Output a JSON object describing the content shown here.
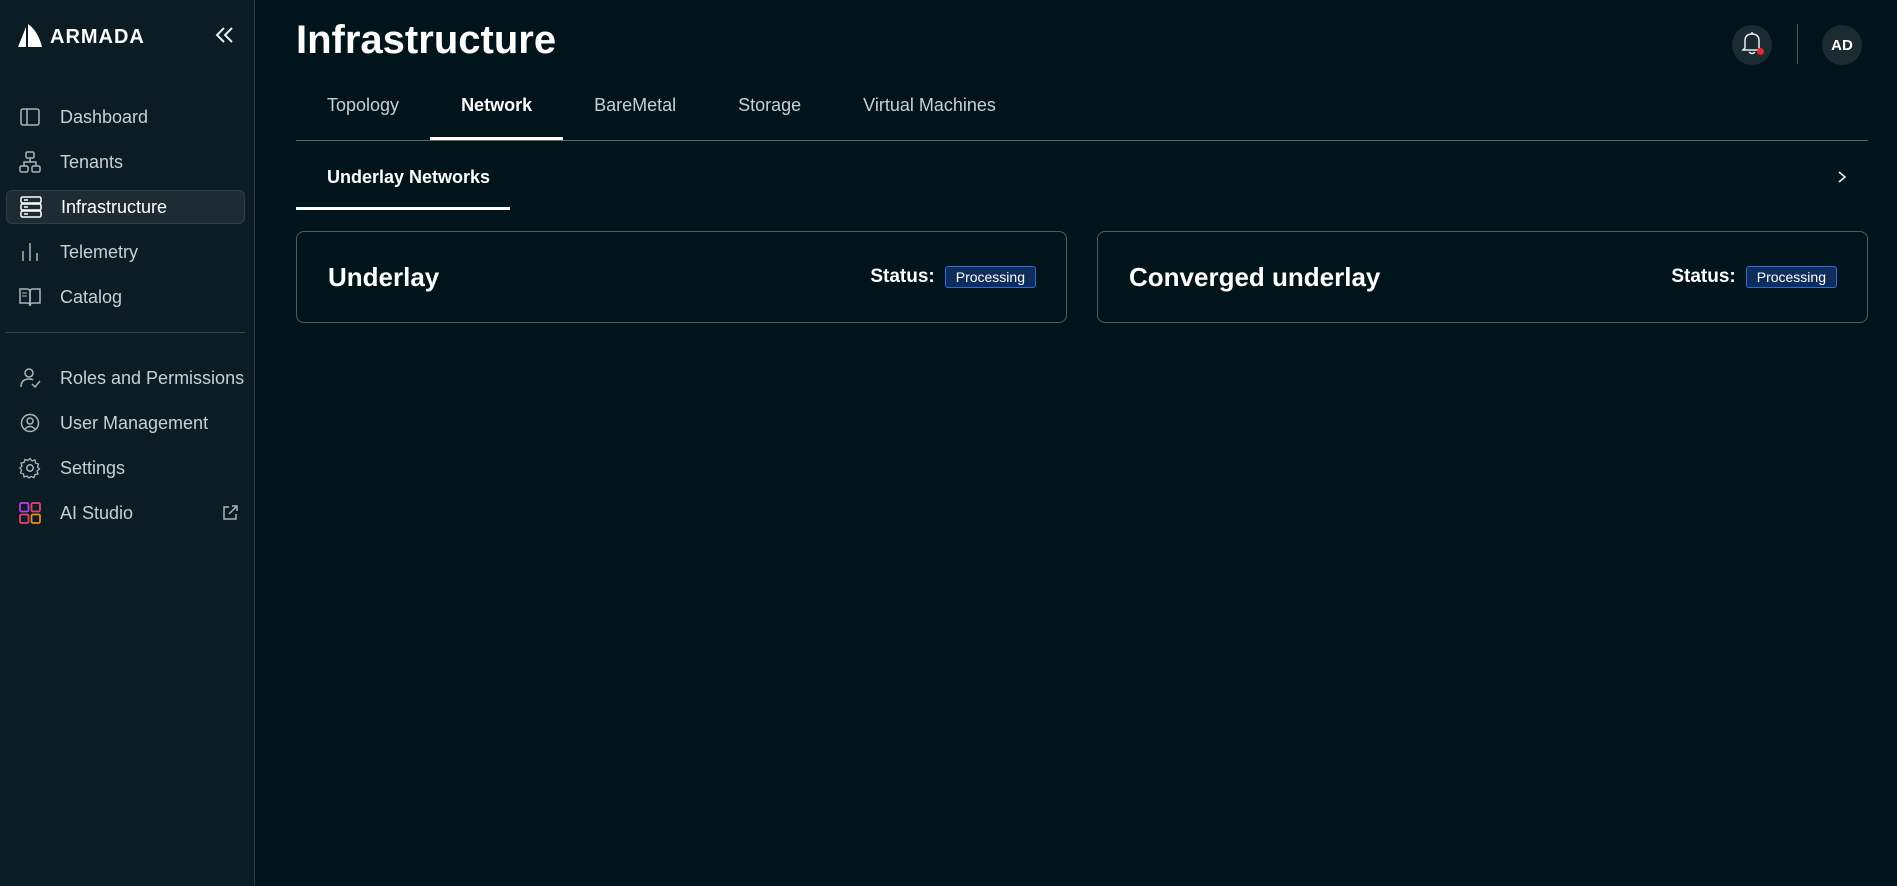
{
  "brand": {
    "name": "ARMADA"
  },
  "sidebar": {
    "primary": [
      {
        "label": "Dashboard",
        "icon": "sidebar-panel-icon",
        "active": false
      },
      {
        "label": "Tenants",
        "icon": "org-hierarchy-icon",
        "active": false
      },
      {
        "label": "Infrastructure",
        "icon": "server-stack-icon",
        "active": true
      },
      {
        "label": "Telemetry",
        "icon": "bar-chart-icon",
        "active": false
      },
      {
        "label": "Catalog",
        "icon": "book-icon",
        "active": false
      }
    ],
    "secondary": [
      {
        "label": "Roles and Permissions",
        "icon": "user-check-icon"
      },
      {
        "label": "User Management",
        "icon": "user-circle-icon"
      },
      {
        "label": "Settings",
        "icon": "gear-icon"
      },
      {
        "label": "AI Studio",
        "icon": "app-grid-icon",
        "external": true
      }
    ]
  },
  "header": {
    "title": "Infrastructure",
    "user_initials": "AD"
  },
  "tabs": [
    {
      "label": "Topology",
      "active": false
    },
    {
      "label": "Network",
      "active": true
    },
    {
      "label": "BareMetal",
      "active": false
    },
    {
      "label": "Storage",
      "active": false
    },
    {
      "label": "Virtual Machines",
      "active": false
    }
  ],
  "subtabs": [
    {
      "label": "Underlay Networks",
      "active": true
    }
  ],
  "cards": [
    {
      "title": "Underlay",
      "status_label": "Status:",
      "status": "Processing"
    },
    {
      "title": "Converged underlay",
      "status_label": "Status:",
      "status": "Processing"
    }
  ],
  "colors": {
    "background": "#02141b",
    "sidebar": "#0c1c24",
    "badge_bg": "#0e2d5a",
    "badge_border": "#2f6ad8",
    "notification_dot": "#e5282d"
  }
}
